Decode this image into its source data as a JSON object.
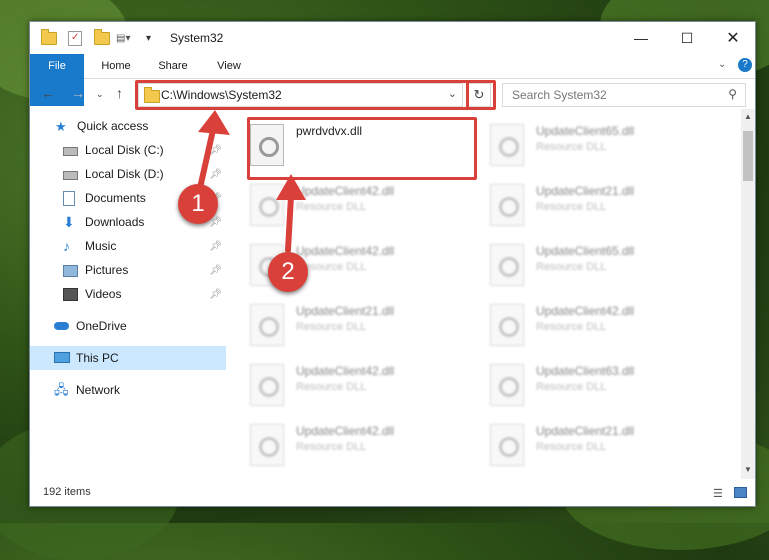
{
  "window": {
    "title": "System32"
  },
  "ribbon": {
    "tabs": [
      "File",
      "Home",
      "Share",
      "View"
    ]
  },
  "navigation": {
    "address": "C:\\Windows\\System32",
    "search_placeholder": "Search System32"
  },
  "sidebar": {
    "items": [
      {
        "label": "Quick access",
        "icon": "star-icon",
        "pinned": false
      },
      {
        "label": "Local Disk (C:)",
        "icon": "drive-icon",
        "pinned": true
      },
      {
        "label": "Local Disk (D:)",
        "icon": "drive-icon",
        "pinned": true
      },
      {
        "label": "Documents",
        "icon": "document-icon",
        "pinned": true
      },
      {
        "label": "Downloads",
        "icon": "download-icon",
        "pinned": true
      },
      {
        "label": "Music",
        "icon": "music-icon",
        "pinned": true
      },
      {
        "label": "Pictures",
        "icon": "picture-icon",
        "pinned": true
      },
      {
        "label": "Videos",
        "icon": "video-icon",
        "pinned": true
      },
      {
        "label": "OneDrive",
        "icon": "cloud-icon",
        "pinned": false
      },
      {
        "label": "This PC",
        "icon": "computer-icon",
        "pinned": false,
        "selected": true
      },
      {
        "label": "Network",
        "icon": "network-icon",
        "pinned": false
      }
    ]
  },
  "files": [
    {
      "name": "pwrdvdvx.dll",
      "desc": ""
    },
    {
      "name": "UpdateClient65.dll",
      "desc": "Resource DLL"
    },
    {
      "name": "UpdateClient42.dll",
      "desc": "Resource DLL"
    },
    {
      "name": "UpdateClient21.dll",
      "desc": "Resource DLL"
    },
    {
      "name": "UpdateClient42.dll",
      "desc": "Resource DLL"
    },
    {
      "name": "UpdateClient65.dll",
      "desc": "Resource DLL"
    },
    {
      "name": "UpdateClient21.dll",
      "desc": "Resource DLL"
    },
    {
      "name": "UpdateClient42.dll",
      "desc": "Resource DLL"
    },
    {
      "name": "UpdateClient42.dll",
      "desc": "Resource DLL"
    },
    {
      "name": "UpdateClient63.dll",
      "desc": "Resource DLL"
    },
    {
      "name": "UpdateClient42.dll",
      "desc": "Resource DLL"
    },
    {
      "name": "UpdateClient21.dll",
      "desc": "Resource DLL"
    }
  ],
  "status": {
    "item_count": "192 items"
  },
  "annotations": {
    "step1": "1",
    "step2": "2",
    "highlight_color": "#d9403a"
  },
  "colors": {
    "file_tab": "#1979ca",
    "selected": "#cce8ff"
  }
}
